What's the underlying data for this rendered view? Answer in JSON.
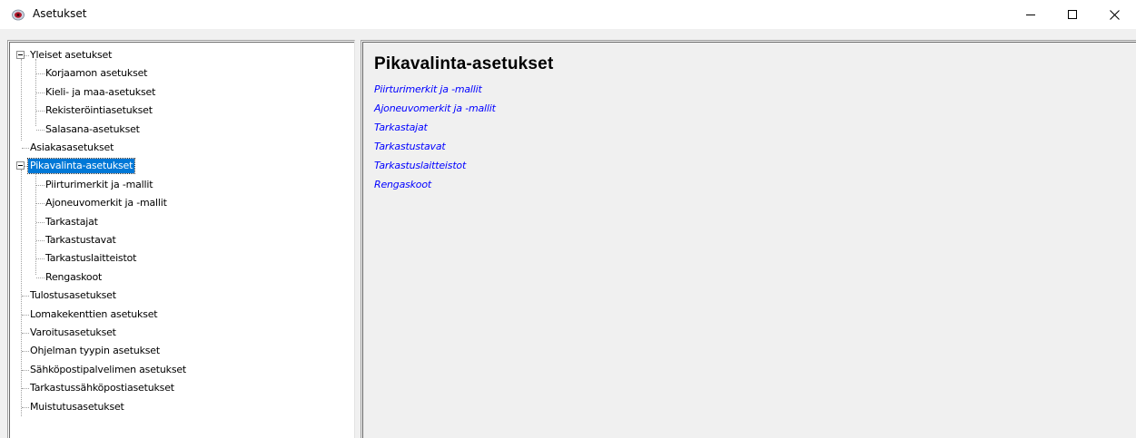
{
  "window": {
    "title": "Asetukset",
    "controls": [
      "minimize",
      "maximize",
      "close"
    ],
    "app_icon": "red-eye-icon"
  },
  "tree": {
    "nodes": [
      {
        "label": "Yleiset asetukset",
        "level": 0,
        "expander": "minus"
      },
      {
        "label": "Korjaamon asetukset",
        "level": 1
      },
      {
        "label": "Kieli- ja maa-asetukset",
        "level": 1
      },
      {
        "label": "Rekisteröintiasetukset",
        "level": 1
      },
      {
        "label": "Salasana-asetukset",
        "level": 1
      },
      {
        "label": "Asiakasasetukset",
        "level": 0
      },
      {
        "label": "Pikavalinta-asetukset",
        "level": 0,
        "expander": "minus",
        "selected": true
      },
      {
        "label": "Piirturimerkit ja -mallit",
        "level": 1
      },
      {
        "label": "Ajoneuvomerkit ja -mallit",
        "level": 1
      },
      {
        "label": "Tarkastajat",
        "level": 1
      },
      {
        "label": "Tarkastustavat",
        "level": 1
      },
      {
        "label": "Tarkastuslaitteistot",
        "level": 1
      },
      {
        "label": "Rengaskoot",
        "level": 1
      },
      {
        "label": "Tulostusasetukset",
        "level": 0
      },
      {
        "label": "Lomakekenttien asetukset",
        "level": 0
      },
      {
        "label": "Varoitusasetukset",
        "level": 0
      },
      {
        "label": "Ohjelman tyypin asetukset",
        "level": 0
      },
      {
        "label": "Sähköpostipalvelimen asetukset",
        "level": 0
      },
      {
        "label": "Tarkastussähköpostiasetukset",
        "level": 0
      },
      {
        "label": "Muistutusasetukset",
        "level": 0
      }
    ]
  },
  "panel": {
    "heading": "Pikavalinta-asetukset",
    "links": [
      "Piirturimerkit ja -mallit",
      "Ajoneuvomerkit ja -mallit",
      "Tarkastajat",
      "Tarkastustavat",
      "Tarkastuslaitteistot",
      "Rengaskoot"
    ],
    "link_color": "#0000ff",
    "selection_color": "#0078d7"
  }
}
